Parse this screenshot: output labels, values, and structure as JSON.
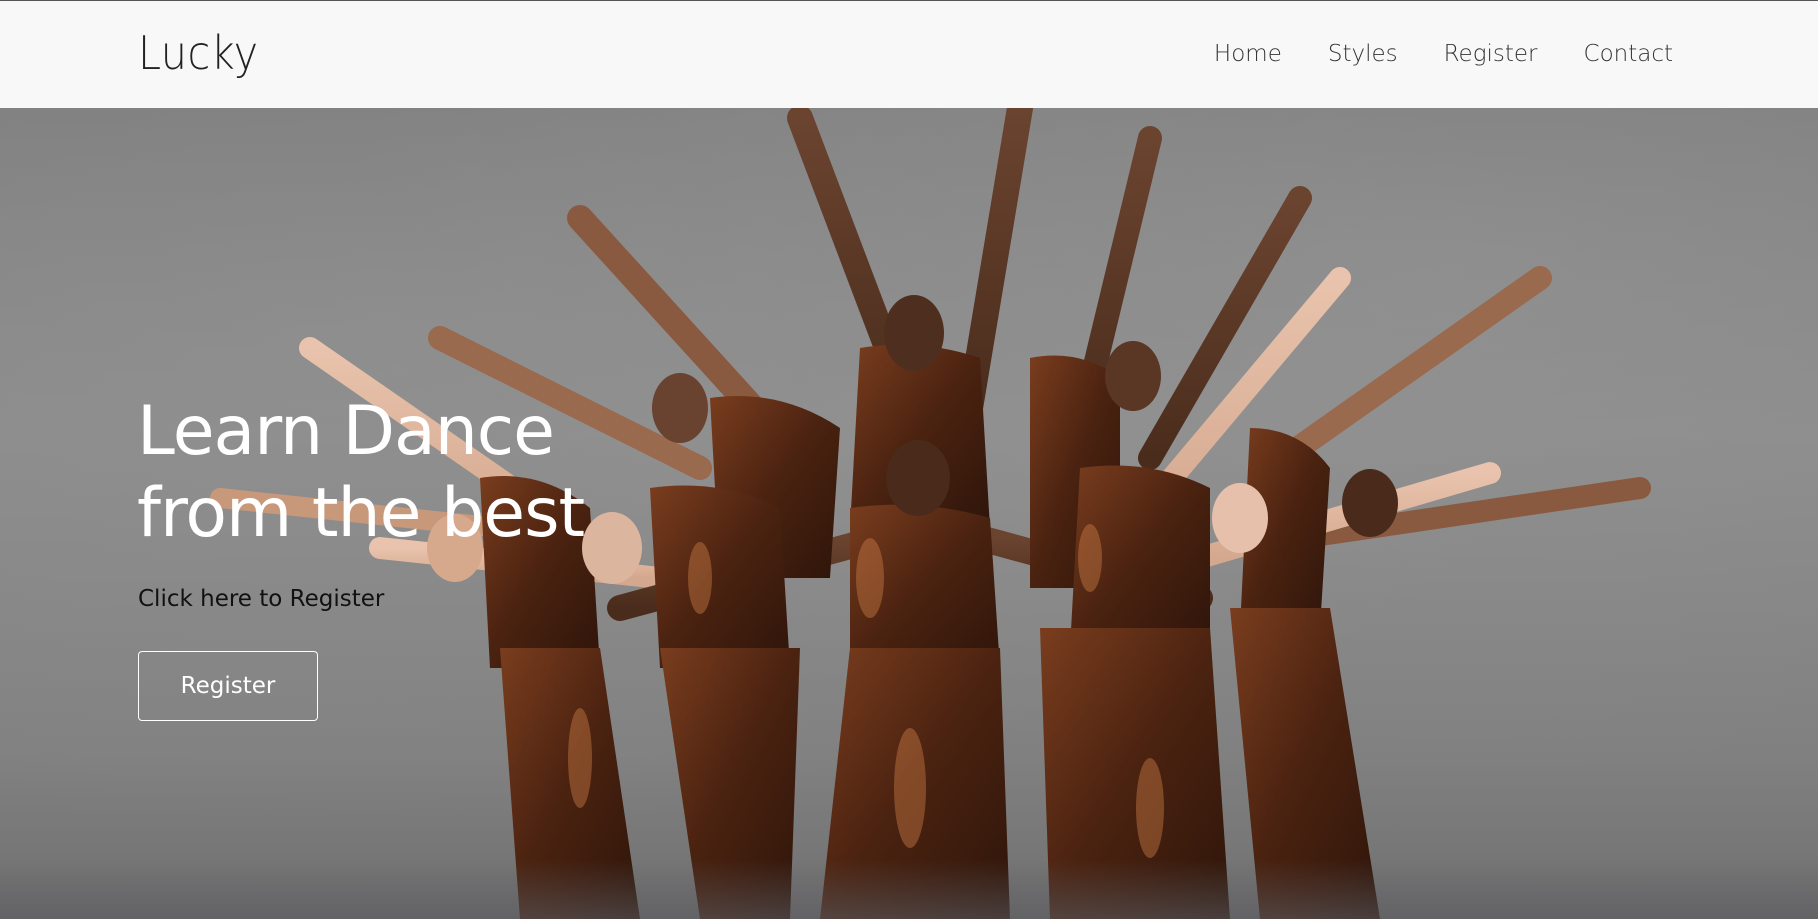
{
  "navbar": {
    "brand": "Lucky",
    "links": [
      {
        "label": "Home"
      },
      {
        "label": "Styles"
      },
      {
        "label": "Register"
      },
      {
        "label": "Contact"
      }
    ]
  },
  "hero": {
    "title_line1": "Learn Dance",
    "title_line2": "from the best",
    "subtitle": "Click here to Register",
    "button_label": "Register",
    "background_image": "group-of-dancers-photo"
  },
  "colors": {
    "navbar_bg": "#f8f8f8",
    "hero_text": "#ffffff",
    "costume": "#5a2e18"
  }
}
